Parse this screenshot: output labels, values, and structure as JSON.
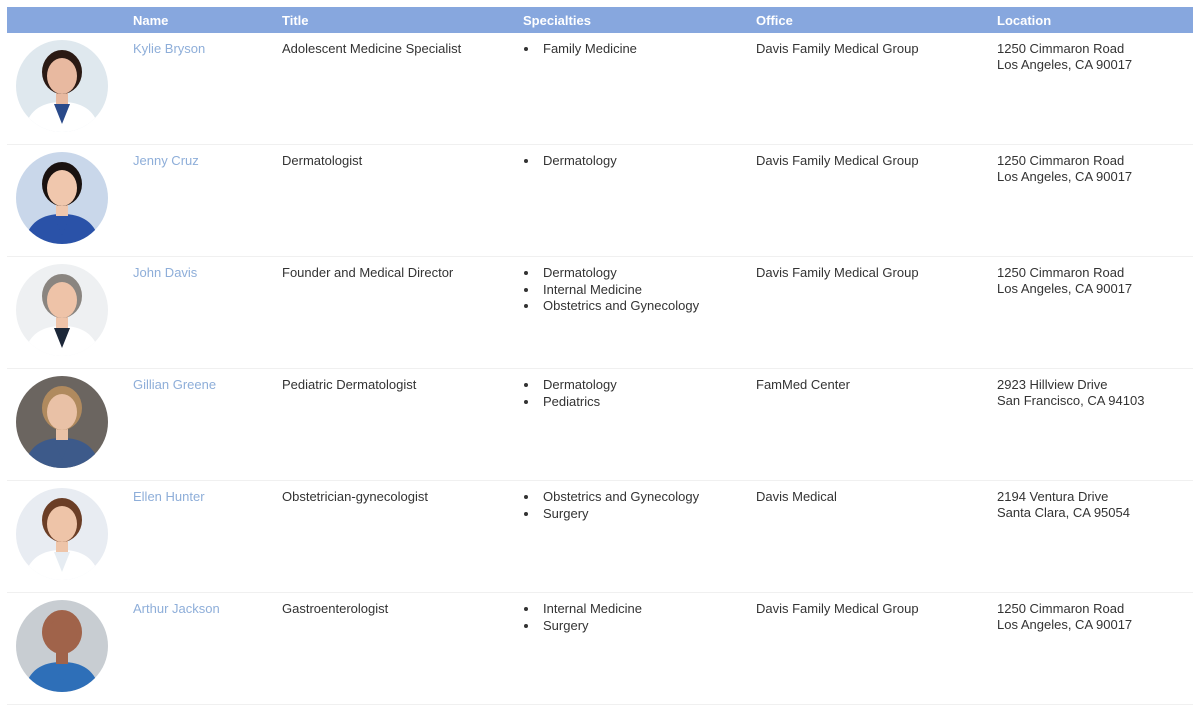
{
  "table": {
    "headers": {
      "photo": "",
      "name": "Name",
      "title": "Title",
      "specialties": "Specialties",
      "office": "Office",
      "location": "Location"
    },
    "colors": {
      "header_bg": "#87a7de",
      "name_link": "#8eaed9"
    },
    "rows": [
      {
        "name": "Kylie Bryson",
        "title": "Adolescent Medicine Specialist",
        "specialties": [
          "Family Medicine"
        ],
        "office": "Davis Family Medical Group",
        "location": {
          "line1": "1250 Cimmaron Road",
          "line2": "Los Angeles, CA 90017"
        },
        "photo": {
          "icon": "doctor-photo",
          "skin": "#e8b9a0",
          "hair": "#2b1a14",
          "coat": "#ffffff",
          "shirt": "#2a4a8a",
          "bg": "#dfe8ee"
        }
      },
      {
        "name": "Jenny Cruz",
        "title": "Dermatologist",
        "specialties": [
          "Dermatology"
        ],
        "office": "Davis Family Medical Group",
        "location": {
          "line1": "1250 Cimmaron Road",
          "line2": "Los Angeles, CA 90017"
        },
        "photo": {
          "icon": "doctor-photo",
          "skin": "#f0c7ad",
          "hair": "#1a1210",
          "coat": "#2a52a8",
          "shirt": "#2a52a8",
          "bg": "#c9d7ea"
        }
      },
      {
        "name": "John Davis",
        "title": "Founder and Medical Director",
        "specialties": [
          "Dermatology",
          "Internal Medicine",
          "Obstetrics and Gynecology"
        ],
        "office": "Davis Family Medical Group",
        "location": {
          "line1": "1250 Cimmaron Road",
          "line2": "Los Angeles, CA 90017"
        },
        "photo": {
          "icon": "doctor-photo",
          "skin": "#eec3a8",
          "hair": "#8a8580",
          "coat": "#ffffff",
          "shirt": "#1c2738",
          "bg": "#eef0f2"
        }
      },
      {
        "name": "Gillian Greene",
        "title": "Pediatric Dermatologist",
        "specialties": [
          "Dermatology",
          "Pediatrics"
        ],
        "office": "FamMed Center",
        "location": {
          "line1": "2923 Hillview Drive",
          "line2": "San Francisco, CA 94103"
        },
        "photo": {
          "icon": "doctor-photo",
          "skin": "#e9c1a6",
          "hair": "#b08a5e",
          "coat": "#3d5a8a",
          "shirt": "#3d5a8a",
          "bg": "#6b6560"
        }
      },
      {
        "name": "Ellen Hunter",
        "title": "Obstetrician-gynecologist",
        "specialties": [
          "Obstetrics and Gynecology",
          "Surgery"
        ],
        "office": "Davis Medical",
        "location": {
          "line1": "2194 Ventura Drive",
          "line2": "Santa Clara, CA 95054"
        },
        "photo": {
          "icon": "doctor-photo",
          "skin": "#eec4a8",
          "hair": "#6b3e26",
          "coat": "#ffffff",
          "shirt": "#e6ecf2",
          "bg": "#e8ecf2"
        }
      },
      {
        "name": "Arthur Jackson",
        "title": "Gastroenterologist",
        "specialties": [
          "Internal Medicine",
          "Surgery"
        ],
        "office": "Davis Family Medical Group",
        "location": {
          "line1": "1250 Cimmaron Road",
          "line2": "Los Angeles, CA 90017"
        },
        "photo": {
          "icon": "doctor-photo",
          "skin": "#a0634a",
          "hair": "#a0634a",
          "coat": "#2e6fb8",
          "shirt": "#2e6fb8",
          "bg": "#c8cdd2"
        }
      }
    ]
  }
}
